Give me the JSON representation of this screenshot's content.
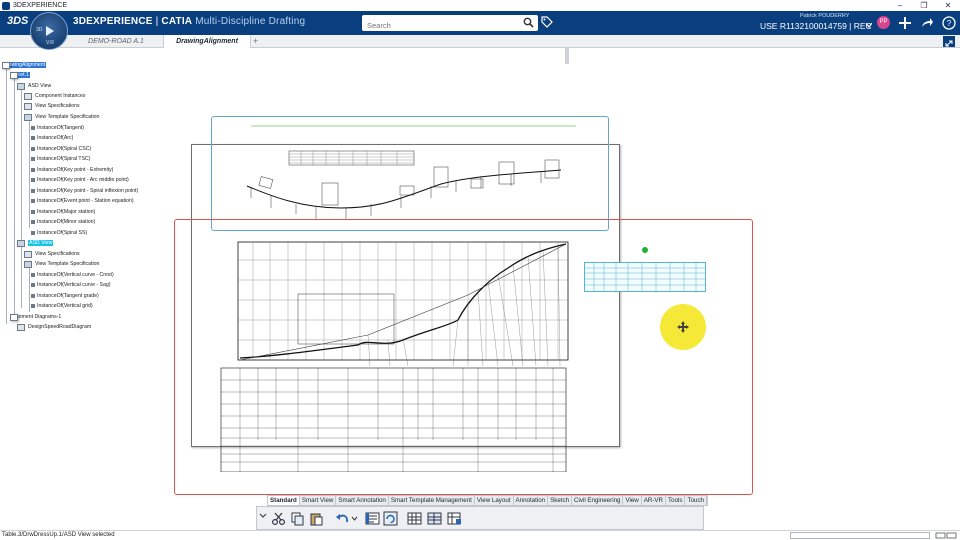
{
  "os": {
    "title": "3DEXPERIENCE"
  },
  "header": {
    "logo": "3DS",
    "brand_bold": "3DEXPERIENCE",
    "brand_sep": " | ",
    "brand_app": "CATIA",
    "brand_role": " Multi-Discipline Drafting",
    "search_placeholder": "Search",
    "user_name": "Patrick POUDERRY",
    "tenant": "USE R1132100014759 | REC",
    "avatar_initials": "PP"
  },
  "compass": {
    "top": "3D",
    "bottom": "V.R"
  },
  "tabs": [
    {
      "label": "DEMO-ROAD A.1",
      "active": false
    },
    {
      "label": "DrawingAlignment",
      "active": true
    }
  ],
  "tree": {
    "items": [
      {
        "label": "DrawingAlignment"
      },
      {
        "label": "Sheet.1"
      },
      {
        "label": "ASD View"
      },
      {
        "label": "Component Instances"
      },
      {
        "label": "View Specifications"
      },
      {
        "label": "View Template Specification"
      },
      {
        "label": "InstanceOf(Tangent)"
      },
      {
        "label": "InstanceOf(Arc)"
      },
      {
        "label": "InstanceOf(Spiral CSC)"
      },
      {
        "label": "InstanceOf(Spiral TSC)"
      },
      {
        "label": "InstanceOf(Key point - Extremity)"
      },
      {
        "label": "InstanceOf(Key point - Arc middle point)"
      },
      {
        "label": "InstanceOf(Key point - Spiral inflexion point)"
      },
      {
        "label": "InstanceOf(Event point - Station equation)"
      },
      {
        "label": "InstanceOf(Major station)"
      },
      {
        "label": "InstanceOf(Minor station)"
      },
      {
        "label": "InstanceOf(Spiral SS)"
      },
      {
        "label": "ASD View"
      },
      {
        "label": "View Specifications"
      },
      {
        "label": "View Template Specification"
      },
      {
        "label": "InstanceOf(Vertical curve - Crest)"
      },
      {
        "label": "InstanceOf(Vertical curve - Sag)"
      },
      {
        "label": "InstanceOf(Tangent grade)"
      },
      {
        "label": "InstanceOf(Vertical grid)"
      },
      {
        "label": "Alignment Diagrams-1"
      },
      {
        "label": "DesignSpeedRoadDiagram"
      }
    ]
  },
  "toolbar": {
    "sections": [
      {
        "label": "Standard",
        "active": true
      },
      {
        "label": "Smart View"
      },
      {
        "label": "Smart Annotation"
      },
      {
        "label": "Smart Template Management"
      },
      {
        "label": "View Layout"
      },
      {
        "label": "Annotation"
      },
      {
        "label": "Sketch"
      },
      {
        "label": "Civil Engineering"
      },
      {
        "label": "View"
      },
      {
        "label": "AR-VR"
      },
      {
        "label": "Tools"
      },
      {
        "label": "Touch"
      }
    ]
  },
  "status": {
    "text": "Table.3/DrwDressUp.1/ASD View selected"
  }
}
